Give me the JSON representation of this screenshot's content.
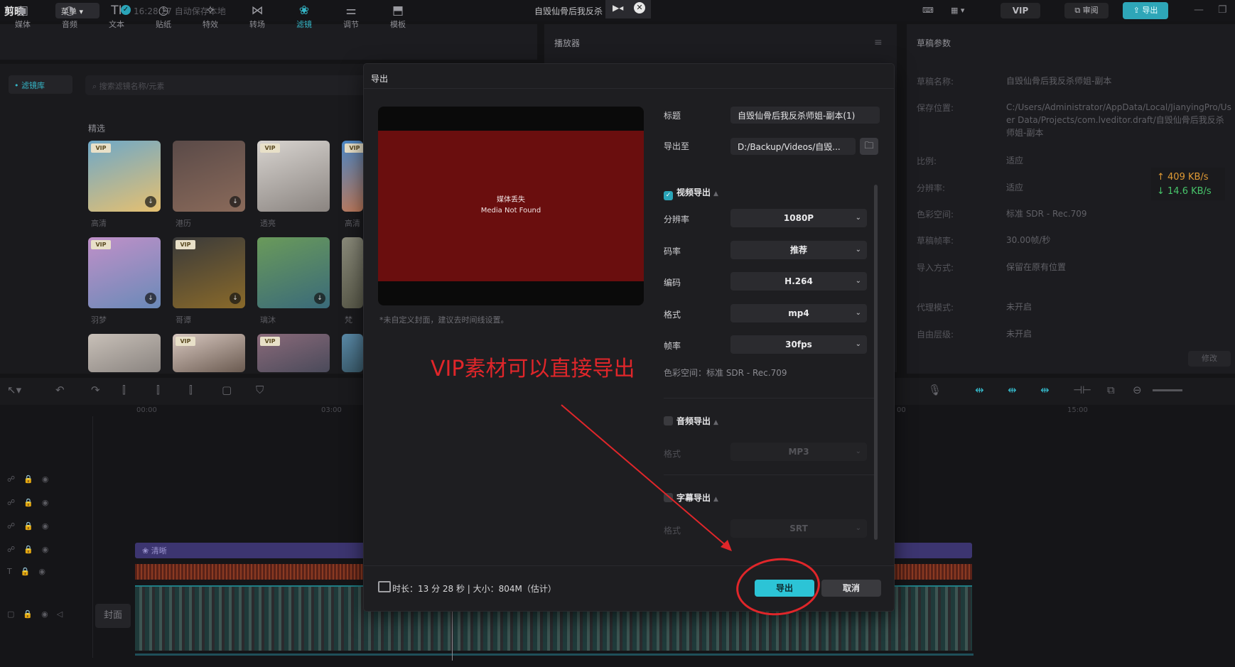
{
  "app": {
    "logo": "剪映",
    "menu": "菜单",
    "autosave": "16:28:27 自动保存本地",
    "project_title": "自毁仙骨后我反杀",
    "vip": "VIP",
    "review": "审阅",
    "export": "导出"
  },
  "toolbar": [
    {
      "label": "媒体",
      "icon": "media-icon"
    },
    {
      "label": "音频",
      "icon": "audio-icon"
    },
    {
      "label": "文本",
      "icon": "text-icon"
    },
    {
      "label": "贴纸",
      "icon": "sticker-icon"
    },
    {
      "label": "特效",
      "icon": "effects-icon"
    },
    {
      "label": "转场",
      "icon": "transition-icon"
    },
    {
      "label": "滤镜",
      "icon": "filter-icon"
    },
    {
      "label": "调节",
      "icon": "adjust-icon"
    },
    {
      "label": "模板",
      "icon": "template-icon"
    }
  ],
  "library": {
    "side_item": "滤镜库",
    "search_placeholder": "搜索滤镜名称/元素",
    "section": "精选",
    "row1": [
      "高清",
      "港历",
      "透亮",
      "高清"
    ],
    "row2": [
      "羽梦",
      "哥谭",
      "璃沐",
      "梵"
    ]
  },
  "player": {
    "title": "播放器"
  },
  "params": {
    "title": "草稿参数",
    "rows": [
      {
        "key": "草稿名称:",
        "value": "自毁仙骨后我反杀师姐-副本"
      },
      {
        "key": "保存位置:",
        "value": "C:/Users/Administrator/AppData/Local/JianyingPro/User Data/Projects/com.lveditor.draft/自毁仙骨后我反杀师姐-副本"
      },
      {
        "key": "比例:",
        "value": "适应"
      },
      {
        "key": "分辨率:",
        "value": "适应"
      },
      {
        "key": "色彩空间:",
        "value": "标准 SDR - Rec.709"
      },
      {
        "key": "草稿帧率:",
        "value": "30.00帧/秒"
      },
      {
        "key": "导入方式:",
        "value": "保留在原有位置"
      },
      {
        "key": "代理模式:",
        "value": "未开启"
      },
      {
        "key": "自由层级:",
        "value": "未开启"
      }
    ],
    "edit": "修改",
    "net_up": "↑ 409 KB/s",
    "net_down": "↓ 14.6 KB/s"
  },
  "timeline": {
    "ruler": [
      "00:00",
      "03:00",
      "00",
      "15:00"
    ],
    "filter_clip": "清晰",
    "cover": "封面"
  },
  "dialog": {
    "title": "导出",
    "preview_line1": "媒体丢失",
    "preview_line2": "Media Not Found",
    "cover_tip": "*未自定义封面，建议去时间线设置。",
    "title_label": "标题",
    "title_value": "自毁仙骨后我反杀师姐-副本(1)",
    "export_to_label": "导出至",
    "export_to_value": "D:/Backup/Videos/自毁...",
    "video_section": "视频导出",
    "resolution_label": "分辨率",
    "resolution_value": "1080P",
    "bitrate_label": "码率",
    "bitrate_value": "推荐",
    "codec_label": "编码",
    "codec_value": "H.264",
    "format_label": "格式",
    "format_value": "mp4",
    "fps_label": "帧率",
    "fps_value": "30fps",
    "colorspace": "色彩空间：标准 SDR - Rec.709",
    "audio_section": "音频导出",
    "audio_format_label": "格式",
    "audio_format_value": "MP3",
    "subtitle_section": "字幕导出",
    "subtitle_format_label": "格式",
    "subtitle_format_value": "SRT",
    "footer_info": "时长：13 分 28 秒 | 大小：804M（估计）",
    "export_button": "导出",
    "cancel_button": "取消"
  },
  "annotation": {
    "text": "VIP素材可以直接导出",
    "color": "#e0262a"
  }
}
